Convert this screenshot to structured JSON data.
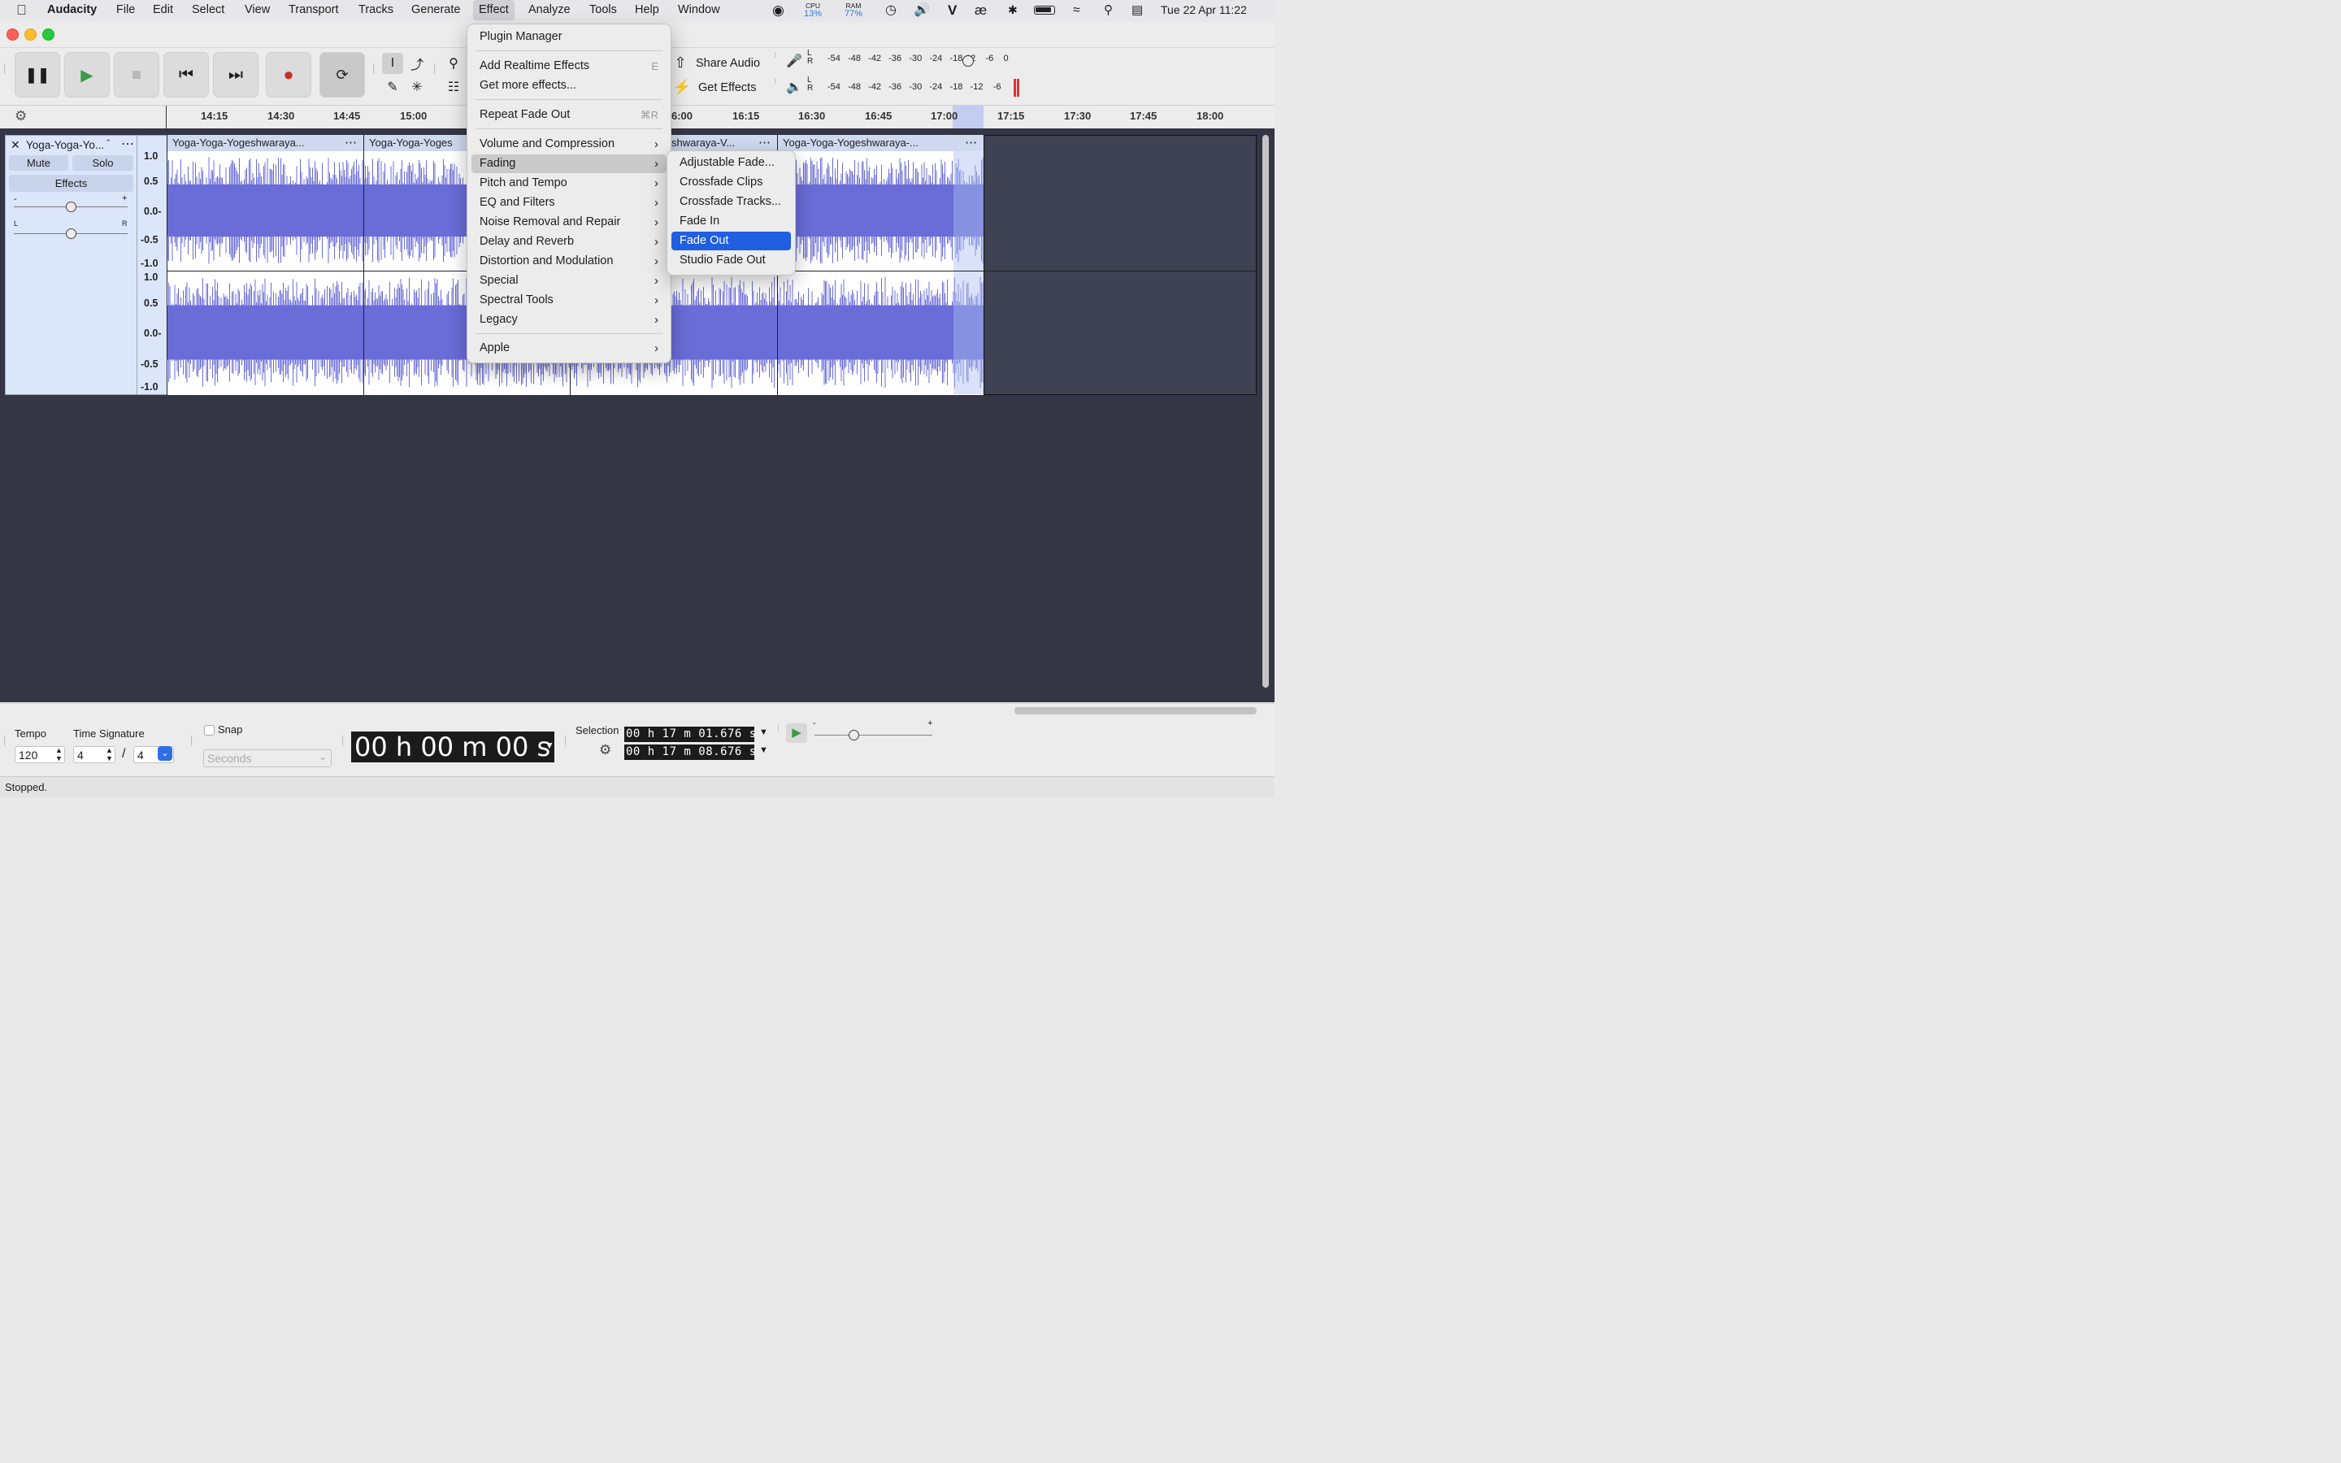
{
  "menubar": {
    "app_name": "Audacity",
    "items": [
      "File",
      "Edit",
      "Select",
      "View",
      "Transport",
      "Tracks",
      "Generate",
      "Effect",
      "Analyze",
      "Tools",
      "Help",
      "Window"
    ],
    "active_item": "Effect",
    "status": {
      "cpu_label": "CPU",
      "cpu_value": "13%",
      "ram_label": "RAM",
      "ram_value": "77%",
      "datetime": "Tue 22 Apr  11:22"
    }
  },
  "toolbar": {
    "share_audio": "Share Audio",
    "get_effects": "Get Effects",
    "meter_scale": [
      "-54",
      "-48",
      "-42",
      "-36",
      "-30",
      "-24",
      "-18",
      "-12",
      "-6",
      "0"
    ],
    "meter_lr": [
      "L",
      "R"
    ]
  },
  "ruler": {
    "ticks": [
      "14:15",
      "14:30",
      "14:45",
      "15:00",
      "16:00",
      "16:15",
      "16:30",
      "16:45",
      "17:00",
      "17:15",
      "17:30",
      "17:45",
      "18:00"
    ],
    "partial_tick": "6:00"
  },
  "track": {
    "name": "Yoga-Yoga-Yo...",
    "mute": "Mute",
    "solo": "Solo",
    "effects": "Effects",
    "gain_minus": "-",
    "gain_plus": "+",
    "pan_left": "L",
    "pan_right": "R",
    "scale_labels": [
      "1.0",
      "0.5",
      "0.0-",
      "-0.5",
      "-1.0"
    ],
    "clips": [
      {
        "title": "Yoga-Yoga-Yogeshwaraya..."
      },
      {
        "title": "Yoga-Yoga-Yoges"
      },
      {
        "title": "shwaraya-V..."
      },
      {
        "title": "Yoga-Yoga-Yogeshwaraya-..."
      }
    ]
  },
  "effect_menu": {
    "items": [
      {
        "label": "Plugin Manager",
        "shortcut": "",
        "submenu": false
      },
      {
        "label": "Add Realtime Effects",
        "shortcut": "E",
        "submenu": false
      },
      {
        "label": "Get more effects...",
        "shortcut": "",
        "submenu": false
      },
      {
        "label": "Repeat Fade Out",
        "shortcut": "⌘R",
        "submenu": false
      },
      {
        "label": "Volume and Compression",
        "shortcut": "",
        "submenu": true
      },
      {
        "label": "Fading",
        "shortcut": "",
        "submenu": true
      },
      {
        "label": "Pitch and Tempo",
        "shortcut": "",
        "submenu": true
      },
      {
        "label": "EQ and Filters",
        "shortcut": "",
        "submenu": true
      },
      {
        "label": "Noise Removal and Repair",
        "shortcut": "",
        "submenu": true
      },
      {
        "label": "Delay and Reverb",
        "shortcut": "",
        "submenu": true
      },
      {
        "label": "Distortion and Modulation",
        "shortcut": "",
        "submenu": true
      },
      {
        "label": "Special",
        "shortcut": "",
        "submenu": true
      },
      {
        "label": "Spectral Tools",
        "shortcut": "",
        "submenu": true
      },
      {
        "label": "Legacy",
        "shortcut": "",
        "submenu": true
      },
      {
        "label": "Apple",
        "shortcut": "",
        "submenu": true
      }
    ],
    "highlighted": "Fading"
  },
  "fading_submenu": {
    "items": [
      "Adjustable Fade...",
      "Crossfade Clips",
      "Crossfade Tracks...",
      "Fade In",
      "Fade Out",
      "Studio Fade Out"
    ],
    "selected": "Fade Out"
  },
  "bottom": {
    "tempo_label": "Tempo",
    "tempo_value": "120",
    "time_signature_label": "Time Signature",
    "ts_numerator": "4",
    "ts_slash": "/",
    "ts_denominator": "4",
    "snap_label": "Snap",
    "snap_unit": "Seconds",
    "time_display": "00 h 00 m 00 s",
    "selection_label": "Selection",
    "selection_start": "00 h 17 m 01.676 s",
    "selection_end": "00 h 17 m 08.676 s",
    "speed_minus": "-",
    "speed_plus": "+"
  },
  "statusbar": {
    "text": "Stopped."
  }
}
